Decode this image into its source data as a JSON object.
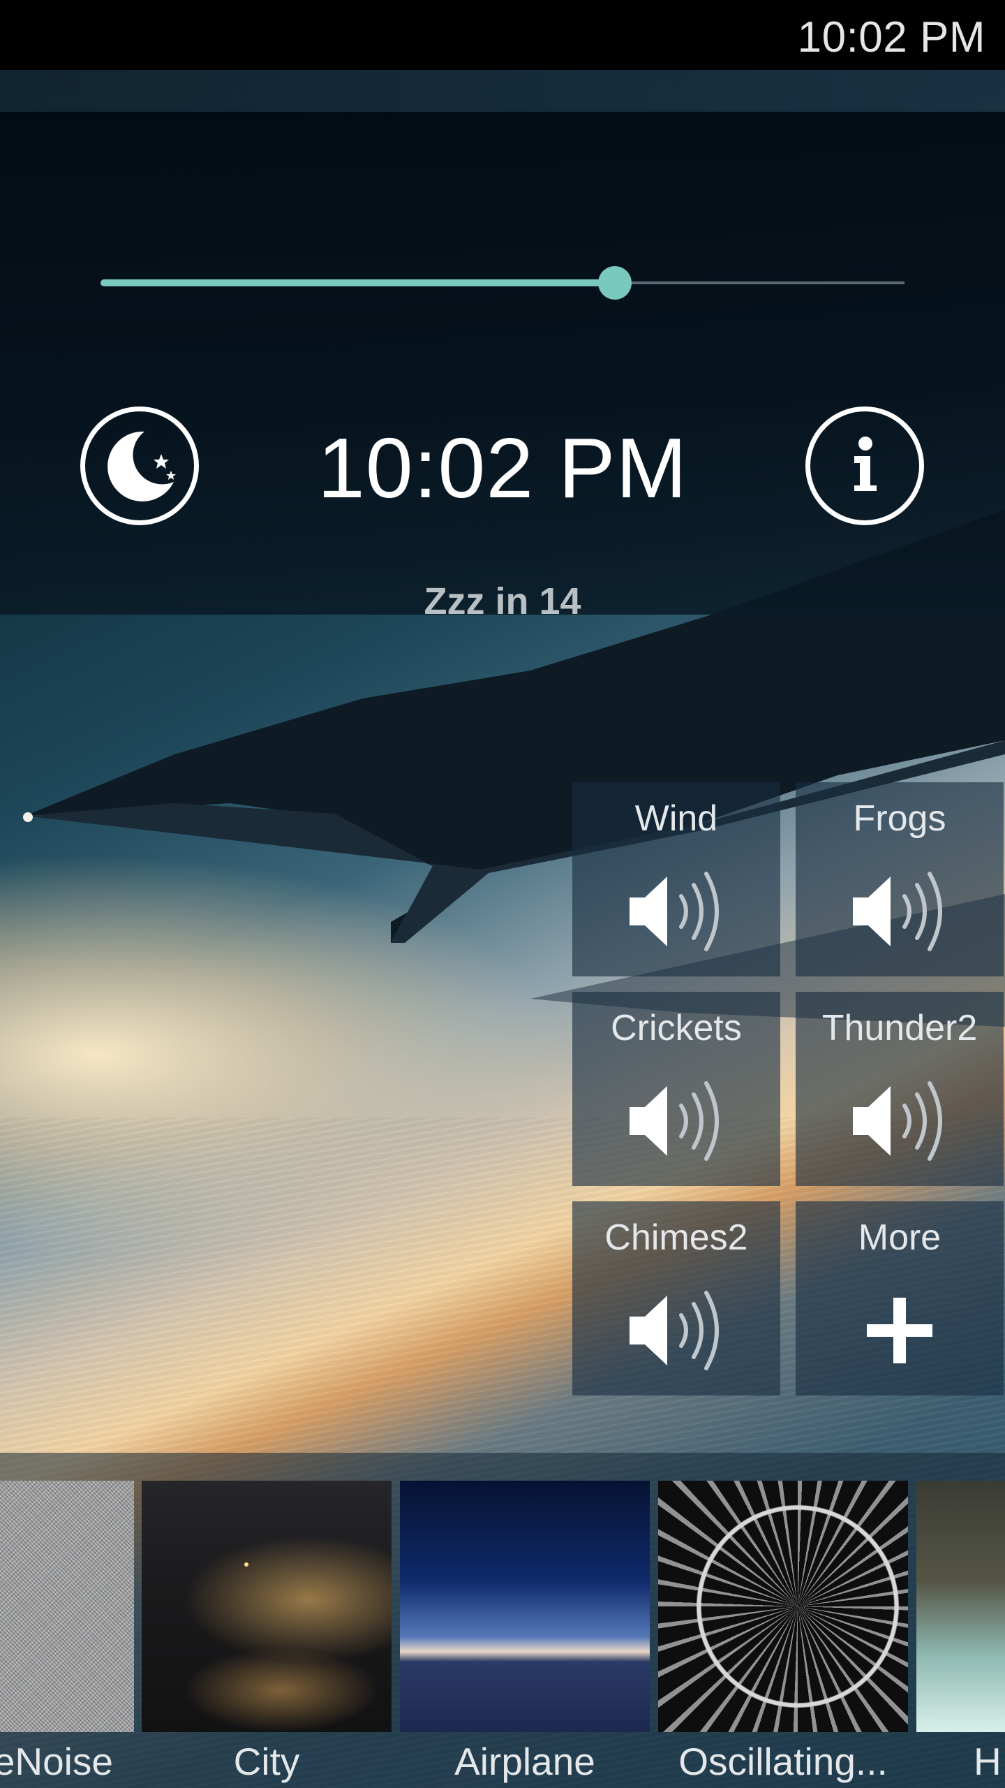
{
  "status_bar": {
    "time": "10:02 PM"
  },
  "controls": {
    "volume_level": 0.64,
    "time": "10:02 PM",
    "sleep_countdown": "Zzz in 14"
  },
  "tiles": [
    {
      "label": "Wind",
      "icon": "speaker-icon"
    },
    {
      "label": "Frogs",
      "icon": "speaker-icon"
    },
    {
      "label": "Crickets",
      "icon": "speaker-icon"
    },
    {
      "label": "Thunder2",
      "icon": "speaker-icon"
    },
    {
      "label": "Chimes2",
      "icon": "speaker-icon"
    },
    {
      "label": "More",
      "icon": "plus-icon"
    }
  ],
  "carousel": [
    {
      "label": "eNoise"
    },
    {
      "label": "City"
    },
    {
      "label": "Airplane"
    },
    {
      "label": "Oscillating..."
    },
    {
      "label": "H"
    }
  ],
  "colors": {
    "accent": "#79c9bd",
    "track": "#5c6a72"
  }
}
